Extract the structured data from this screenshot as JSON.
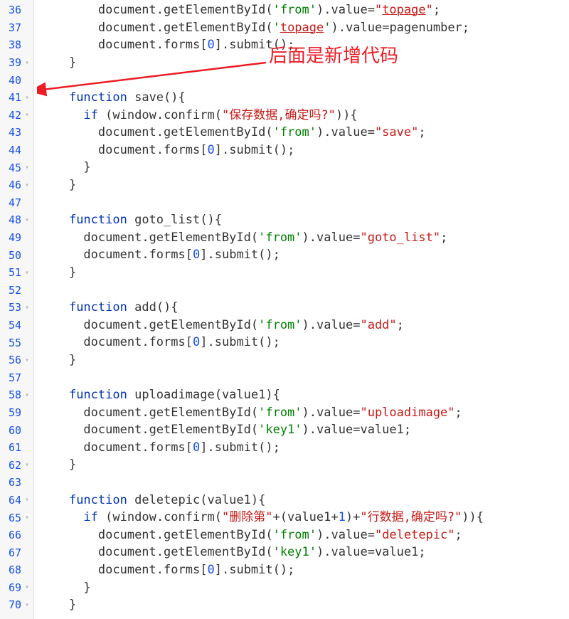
{
  "annotation": {
    "text": "后面是新增代码"
  },
  "lines": [
    {
      "n": 36,
      "fold": "",
      "indent": "        ",
      "tokens": [
        {
          "t": "document",
          "c": ""
        },
        {
          "t": ".",
          "c": ""
        },
        {
          "t": "getElementById",
          "c": ""
        },
        {
          "t": "(",
          "c": ""
        },
        {
          "t": "'from'",
          "c": "str"
        },
        {
          "t": ")",
          "c": ""
        },
        {
          "t": ".",
          "c": ""
        },
        {
          "t": "value",
          "c": ""
        },
        {
          "t": "=",
          "c": ""
        },
        {
          "t": "\"",
          "c": "strpink"
        },
        {
          "t": "topage",
          "c": "pink"
        },
        {
          "t": "\"",
          "c": "strpink"
        },
        {
          "t": ";",
          "c": ""
        }
      ]
    },
    {
      "n": 37,
      "fold": "",
      "indent": "        ",
      "tokens": [
        {
          "t": "document",
          "c": ""
        },
        {
          "t": ".",
          "c": ""
        },
        {
          "t": "getElementById",
          "c": ""
        },
        {
          "t": "(",
          "c": ""
        },
        {
          "t": "'",
          "c": "str"
        },
        {
          "t": "topage",
          "c": "pink"
        },
        {
          "t": "'",
          "c": "str"
        },
        {
          "t": ")",
          "c": ""
        },
        {
          "t": ".",
          "c": ""
        },
        {
          "t": "value",
          "c": ""
        },
        {
          "t": "=",
          "c": ""
        },
        {
          "t": "pagenumber",
          "c": ""
        },
        {
          "t": ";",
          "c": ""
        }
      ]
    },
    {
      "n": 38,
      "fold": "",
      "indent": "        ",
      "tokens": [
        {
          "t": "document",
          "c": ""
        },
        {
          "t": ".",
          "c": ""
        },
        {
          "t": "forms",
          "c": ""
        },
        {
          "t": "[",
          "c": ""
        },
        {
          "t": "0",
          "c": "num"
        },
        {
          "t": "]",
          "c": ""
        },
        {
          "t": ".",
          "c": ""
        },
        {
          "t": "submit",
          "c": ""
        },
        {
          "t": "();",
          "c": ""
        }
      ]
    },
    {
      "n": 39,
      "fold": "▾",
      "indent": "    ",
      "tokens": [
        {
          "t": "}",
          "c": ""
        }
      ]
    },
    {
      "n": 40,
      "fold": "",
      "indent": "",
      "tokens": []
    },
    {
      "n": 41,
      "fold": "▾",
      "indent": "    ",
      "tokens": [
        {
          "t": "function",
          "c": "kw"
        },
        {
          "t": " ",
          "c": ""
        },
        {
          "t": "save",
          "c": ""
        },
        {
          "t": "(){",
          "c": ""
        }
      ]
    },
    {
      "n": 42,
      "fold": "▾",
      "indent": "      ",
      "tokens": [
        {
          "t": "if",
          "c": "kw"
        },
        {
          "t": " (",
          "c": ""
        },
        {
          "t": "window",
          "c": ""
        },
        {
          "t": ".",
          "c": ""
        },
        {
          "t": "confirm",
          "c": ""
        },
        {
          "t": "(",
          "c": ""
        },
        {
          "t": "\"保存数据,确定吗?\"",
          "c": "strpink"
        },
        {
          "t": ")){",
          "c": ""
        }
      ]
    },
    {
      "n": 43,
      "fold": "",
      "indent": "        ",
      "tokens": [
        {
          "t": "document",
          "c": ""
        },
        {
          "t": ".",
          "c": ""
        },
        {
          "t": "getElementById",
          "c": ""
        },
        {
          "t": "(",
          "c": ""
        },
        {
          "t": "'from'",
          "c": "str"
        },
        {
          "t": ")",
          "c": ""
        },
        {
          "t": ".",
          "c": ""
        },
        {
          "t": "value",
          "c": ""
        },
        {
          "t": "=",
          "c": ""
        },
        {
          "t": "\"save\"",
          "c": "strpink"
        },
        {
          "t": ";",
          "c": ""
        }
      ]
    },
    {
      "n": 44,
      "fold": "",
      "indent": "        ",
      "tokens": [
        {
          "t": "document",
          "c": ""
        },
        {
          "t": ".",
          "c": ""
        },
        {
          "t": "forms",
          "c": ""
        },
        {
          "t": "[",
          "c": ""
        },
        {
          "t": "0",
          "c": "num"
        },
        {
          "t": "]",
          "c": ""
        },
        {
          "t": ".",
          "c": ""
        },
        {
          "t": "submit",
          "c": ""
        },
        {
          "t": "();",
          "c": ""
        }
      ]
    },
    {
      "n": 45,
      "fold": "▾",
      "indent": "      ",
      "tokens": [
        {
          "t": "}",
          "c": ""
        }
      ]
    },
    {
      "n": 46,
      "fold": "▾",
      "indent": "    ",
      "tokens": [
        {
          "t": "}",
          "c": ""
        }
      ]
    },
    {
      "n": 47,
      "fold": "",
      "indent": "",
      "tokens": []
    },
    {
      "n": 48,
      "fold": "▾",
      "indent": "    ",
      "tokens": [
        {
          "t": "function",
          "c": "kw"
        },
        {
          "t": " ",
          "c": ""
        },
        {
          "t": "goto_list",
          "c": ""
        },
        {
          "t": "(){",
          "c": ""
        }
      ]
    },
    {
      "n": 49,
      "fold": "",
      "indent": "      ",
      "tokens": [
        {
          "t": "document",
          "c": ""
        },
        {
          "t": ".",
          "c": ""
        },
        {
          "t": "getElementById",
          "c": ""
        },
        {
          "t": "(",
          "c": ""
        },
        {
          "t": "'from'",
          "c": "str"
        },
        {
          "t": ")",
          "c": ""
        },
        {
          "t": ".",
          "c": ""
        },
        {
          "t": "value",
          "c": ""
        },
        {
          "t": "=",
          "c": ""
        },
        {
          "t": "\"goto_list\"",
          "c": "strpink"
        },
        {
          "t": ";",
          "c": ""
        }
      ]
    },
    {
      "n": 50,
      "fold": "",
      "indent": "      ",
      "tokens": [
        {
          "t": "document",
          "c": ""
        },
        {
          "t": ".",
          "c": ""
        },
        {
          "t": "forms",
          "c": ""
        },
        {
          "t": "[",
          "c": ""
        },
        {
          "t": "0",
          "c": "num"
        },
        {
          "t": "]",
          "c": ""
        },
        {
          "t": ".",
          "c": ""
        },
        {
          "t": "submit",
          "c": ""
        },
        {
          "t": "();",
          "c": ""
        }
      ]
    },
    {
      "n": 51,
      "fold": "▾",
      "indent": "    ",
      "tokens": [
        {
          "t": "}",
          "c": ""
        }
      ]
    },
    {
      "n": 52,
      "fold": "",
      "indent": "",
      "tokens": []
    },
    {
      "n": 53,
      "fold": "▾",
      "indent": "    ",
      "tokens": [
        {
          "t": "function",
          "c": "kw"
        },
        {
          "t": " ",
          "c": ""
        },
        {
          "t": "add",
          "c": ""
        },
        {
          "t": "(){",
          "c": ""
        }
      ]
    },
    {
      "n": 54,
      "fold": "",
      "indent": "      ",
      "tokens": [
        {
          "t": "document",
          "c": ""
        },
        {
          "t": ".",
          "c": ""
        },
        {
          "t": "getElementById",
          "c": ""
        },
        {
          "t": "(",
          "c": ""
        },
        {
          "t": "'from'",
          "c": "str"
        },
        {
          "t": ")",
          "c": ""
        },
        {
          "t": ".",
          "c": ""
        },
        {
          "t": "value",
          "c": ""
        },
        {
          "t": "=",
          "c": ""
        },
        {
          "t": "\"add\"",
          "c": "strpink"
        },
        {
          "t": ";",
          "c": ""
        }
      ]
    },
    {
      "n": 55,
      "fold": "",
      "indent": "      ",
      "tokens": [
        {
          "t": "document",
          "c": ""
        },
        {
          "t": ".",
          "c": ""
        },
        {
          "t": "forms",
          "c": ""
        },
        {
          "t": "[",
          "c": ""
        },
        {
          "t": "0",
          "c": "num"
        },
        {
          "t": "]",
          "c": ""
        },
        {
          "t": ".",
          "c": ""
        },
        {
          "t": "submit",
          "c": ""
        },
        {
          "t": "();",
          "c": ""
        }
      ]
    },
    {
      "n": 56,
      "fold": "▾",
      "indent": "    ",
      "tokens": [
        {
          "t": "}",
          "c": ""
        }
      ]
    },
    {
      "n": 57,
      "fold": "",
      "indent": "",
      "tokens": []
    },
    {
      "n": 58,
      "fold": "▾",
      "indent": "    ",
      "tokens": [
        {
          "t": "function",
          "c": "kw"
        },
        {
          "t": " ",
          "c": ""
        },
        {
          "t": "uploadimage",
          "c": ""
        },
        {
          "t": "(",
          "c": ""
        },
        {
          "t": "value1",
          "c": ""
        },
        {
          "t": "){",
          "c": ""
        }
      ]
    },
    {
      "n": 59,
      "fold": "",
      "indent": "      ",
      "tokens": [
        {
          "t": "document",
          "c": ""
        },
        {
          "t": ".",
          "c": ""
        },
        {
          "t": "getElementById",
          "c": ""
        },
        {
          "t": "(",
          "c": ""
        },
        {
          "t": "'from'",
          "c": "str"
        },
        {
          "t": ")",
          "c": ""
        },
        {
          "t": ".",
          "c": ""
        },
        {
          "t": "value",
          "c": ""
        },
        {
          "t": "=",
          "c": ""
        },
        {
          "t": "\"uploadimage\"",
          "c": "strpink"
        },
        {
          "t": ";",
          "c": ""
        }
      ]
    },
    {
      "n": 60,
      "fold": "",
      "indent": "      ",
      "tokens": [
        {
          "t": "document",
          "c": ""
        },
        {
          "t": ".",
          "c": ""
        },
        {
          "t": "getElementById",
          "c": ""
        },
        {
          "t": "(",
          "c": ""
        },
        {
          "t": "'key1'",
          "c": "str"
        },
        {
          "t": ")",
          "c": ""
        },
        {
          "t": ".",
          "c": ""
        },
        {
          "t": "value",
          "c": ""
        },
        {
          "t": "=",
          "c": ""
        },
        {
          "t": "value1",
          "c": ""
        },
        {
          "t": ";",
          "c": ""
        }
      ]
    },
    {
      "n": 61,
      "fold": "",
      "indent": "      ",
      "tokens": [
        {
          "t": "document",
          "c": ""
        },
        {
          "t": ".",
          "c": ""
        },
        {
          "t": "forms",
          "c": ""
        },
        {
          "t": "[",
          "c": ""
        },
        {
          "t": "0",
          "c": "num"
        },
        {
          "t": "]",
          "c": ""
        },
        {
          "t": ".",
          "c": ""
        },
        {
          "t": "submit",
          "c": ""
        },
        {
          "t": "();",
          "c": ""
        }
      ]
    },
    {
      "n": 62,
      "fold": "▾",
      "indent": "    ",
      "tokens": [
        {
          "t": "}",
          "c": ""
        }
      ]
    },
    {
      "n": 63,
      "fold": "",
      "indent": "",
      "tokens": []
    },
    {
      "n": 64,
      "fold": "▾",
      "indent": "    ",
      "tokens": [
        {
          "t": "function",
          "c": "kw"
        },
        {
          "t": " ",
          "c": ""
        },
        {
          "t": "deletepic",
          "c": ""
        },
        {
          "t": "(",
          "c": ""
        },
        {
          "t": "value1",
          "c": ""
        },
        {
          "t": "){",
          "c": ""
        }
      ]
    },
    {
      "n": 65,
      "fold": "▾",
      "indent": "      ",
      "tokens": [
        {
          "t": "if",
          "c": "kw"
        },
        {
          "t": " (",
          "c": ""
        },
        {
          "t": "window",
          "c": ""
        },
        {
          "t": ".",
          "c": ""
        },
        {
          "t": "confirm",
          "c": ""
        },
        {
          "t": "(",
          "c": ""
        },
        {
          "t": "\"删除第\"",
          "c": "strpink"
        },
        {
          "t": "+(",
          "c": ""
        },
        {
          "t": "value1",
          "c": ""
        },
        {
          "t": "+",
          "c": ""
        },
        {
          "t": "1",
          "c": "num"
        },
        {
          "t": ")+",
          "c": ""
        },
        {
          "t": "\"行数据,确定吗?\"",
          "c": "strpink"
        },
        {
          "t": ")){",
          "c": ""
        }
      ]
    },
    {
      "n": 66,
      "fold": "",
      "indent": "        ",
      "tokens": [
        {
          "t": "document",
          "c": ""
        },
        {
          "t": ".",
          "c": ""
        },
        {
          "t": "getElementById",
          "c": ""
        },
        {
          "t": "(",
          "c": ""
        },
        {
          "t": "'from'",
          "c": "str"
        },
        {
          "t": ")",
          "c": ""
        },
        {
          "t": ".",
          "c": ""
        },
        {
          "t": "value",
          "c": ""
        },
        {
          "t": "=",
          "c": ""
        },
        {
          "t": "\"deletepic\"",
          "c": "strpink"
        },
        {
          "t": ";",
          "c": ""
        }
      ]
    },
    {
      "n": 67,
      "fold": "",
      "indent": "        ",
      "tokens": [
        {
          "t": "document",
          "c": ""
        },
        {
          "t": ".",
          "c": ""
        },
        {
          "t": "getElementById",
          "c": ""
        },
        {
          "t": "(",
          "c": ""
        },
        {
          "t": "'key1'",
          "c": "str"
        },
        {
          "t": ")",
          "c": ""
        },
        {
          "t": ".",
          "c": ""
        },
        {
          "t": "value",
          "c": ""
        },
        {
          "t": "=",
          "c": ""
        },
        {
          "t": "value1",
          "c": ""
        },
        {
          "t": ";",
          "c": ""
        }
      ]
    },
    {
      "n": 68,
      "fold": "",
      "indent": "        ",
      "tokens": [
        {
          "t": "document",
          "c": ""
        },
        {
          "t": ".",
          "c": ""
        },
        {
          "t": "forms",
          "c": ""
        },
        {
          "t": "[",
          "c": ""
        },
        {
          "t": "0",
          "c": "num"
        },
        {
          "t": "]",
          "c": ""
        },
        {
          "t": ".",
          "c": ""
        },
        {
          "t": "submit",
          "c": ""
        },
        {
          "t": "();",
          "c": ""
        }
      ]
    },
    {
      "n": 69,
      "fold": "▾",
      "indent": "      ",
      "tokens": [
        {
          "t": "}",
          "c": ""
        }
      ]
    },
    {
      "n": 70,
      "fold": "▾",
      "indent": "    ",
      "tokens": [
        {
          "t": "}",
          "c": ""
        }
      ]
    }
  ]
}
